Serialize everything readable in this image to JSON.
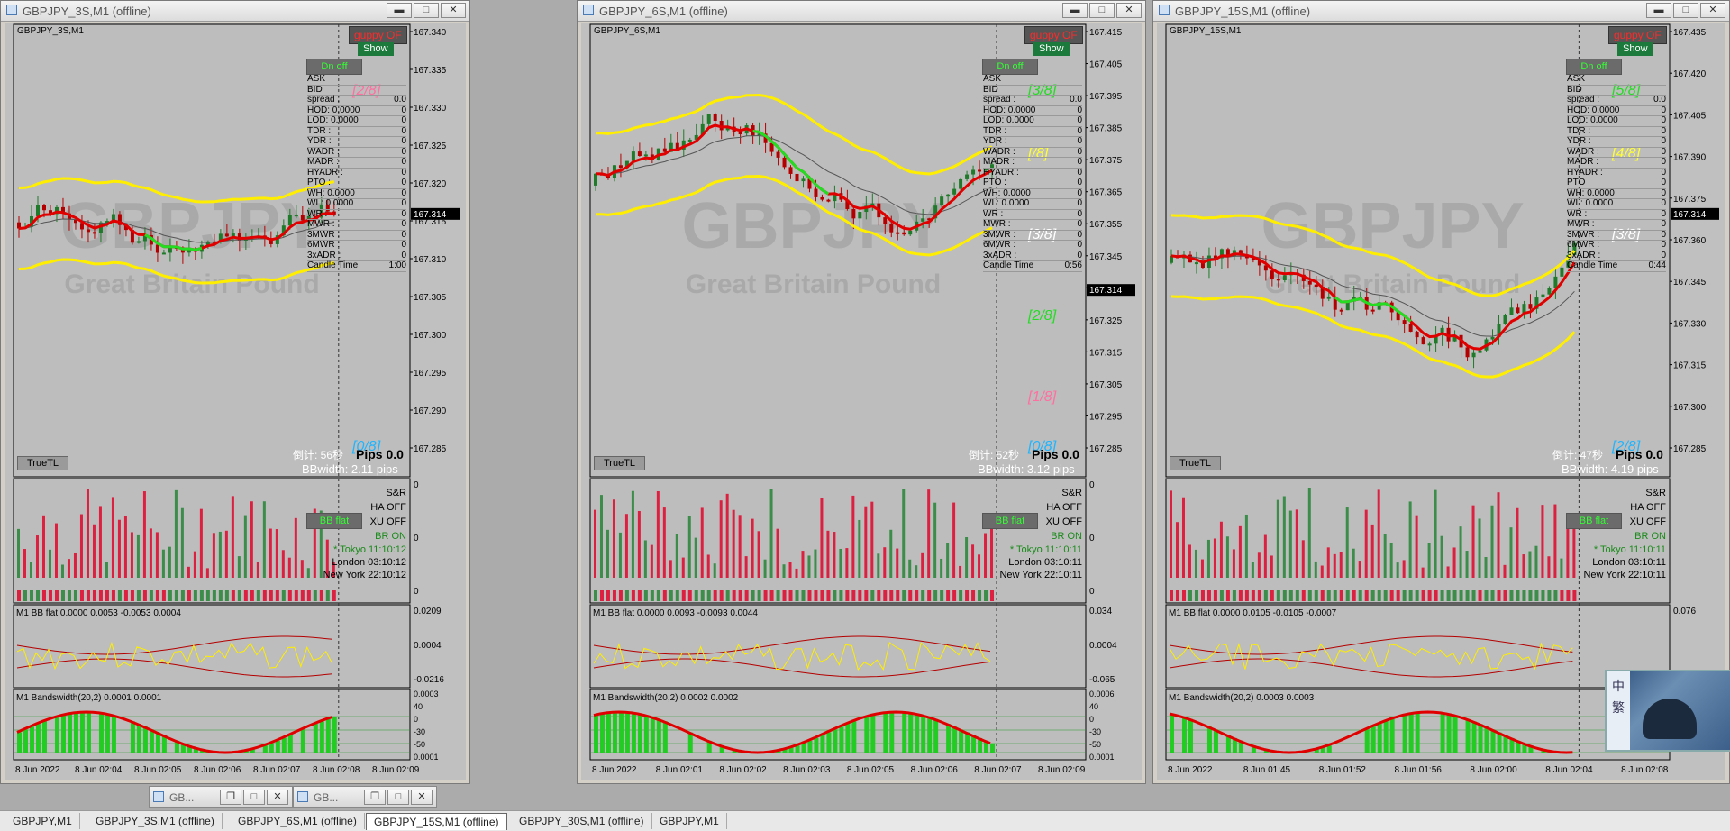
{
  "windows": [
    {
      "title": "GBPJPY_3S,M1 (offline)",
      "symbol_label": "GBPJPY_3S,M1",
      "price_ticks": [
        "167.340",
        "167.335",
        "167.330",
        "167.325",
        "167.320",
        "167.315",
        "167.310",
        "167.305",
        "167.300",
        "167.295",
        "167.290",
        "167.285"
      ],
      "current_price": "167.314",
      "time_labels": [
        "8 Jun 2022",
        "8 Jun 02:04",
        "8 Jun 02:05",
        "8 Jun 02:06",
        "8 Jun 02:07",
        "8 Jun 02:08",
        "8 Jun 02:09"
      ],
      "murrey_top": "[2/8]",
      "murrey_labels": [],
      "murrey_bottom": "[0/8]",
      "countdown": "倒计: 56秒",
      "bbwidth": "BBwidth: 2.11 pips",
      "candle_time": "1:00",
      "sessions": [
        {
          "name": "* Tokyo",
          "time": "11:10:12"
        },
        {
          "name": "London",
          "time": "03:10:12"
        },
        {
          "name": "New York",
          "time": "22:10:12"
        }
      ],
      "bbflat": "M1 BB flat 0.0000 0.0053 -0.0053 0.0004",
      "bbflat_ticks": [
        "0.0209",
        "0.0004",
        "-0.0216"
      ],
      "bw": "M1 Bandswidth(20,2) 0.0001 0.0001",
      "bw_ticks": [
        "0.0003",
        "40",
        "0",
        "-30",
        "-50",
        "0.0001"
      ],
      "vol_ticks": [
        "0",
        "0",
        "0"
      ]
    },
    {
      "title": "GBPJPY_6S,M1 (offline)",
      "symbol_label": "GBPJPY_6S,M1",
      "price_ticks": [
        "167.415",
        "167.405",
        "167.395",
        "167.385",
        "167.375",
        "167.365",
        "167.355",
        "167.345",
        "167.335",
        "167.325",
        "167.315",
        "167.305",
        "167.295",
        "167.285"
      ],
      "current_price": "167.314",
      "time_labels": [
        "8 Jun 2022",
        "8 Jun 02:01",
        "8 Jun 02:02",
        "8 Jun 02:03",
        "8 Jun 02:05",
        "8 Jun 02:06",
        "8 Jun 02:07",
        "8 Jun 02:09"
      ],
      "murrey_top": "[3/8]",
      "murrey_labels": [
        "[/8]",
        "[3/8]",
        "[2/8]",
        "[1/8]"
      ],
      "murrey_bottom": "[0/8]",
      "countdown": "倒计: 52秒",
      "bbwidth": "BBwidth: 3.12 pips",
      "candle_time": "0:56",
      "sessions": [
        {
          "name": "* Tokyo",
          "time": "11:10:11"
        },
        {
          "name": "London",
          "time": "03:10:11"
        },
        {
          "name": "New York",
          "time": "22:10:11"
        }
      ],
      "bbflat": "M1 BB flat 0.0000 0.0093 -0.0093 0.0044",
      "bbflat_ticks": [
        "0.034",
        "0.0004",
        "-0.065"
      ],
      "bw": "M1 Bandswidth(20,2) 0.0002 0.0002",
      "bw_ticks": [
        "0.0006",
        "40",
        "0",
        "-30",
        "-50",
        "0.0001"
      ],
      "vol_ticks": [
        "0",
        "0",
        "0"
      ]
    },
    {
      "title": "GBPJPY_15S,M1 (offline)",
      "symbol_label": "GBPJPY_15S,M1",
      "price_ticks": [
        "167.435",
        "167.420",
        "167.405",
        "167.390",
        "167.375",
        "167.360",
        "167.345",
        "167.330",
        "167.315",
        "167.300",
        "167.285"
      ],
      "current_price": "167.314",
      "time_labels": [
        "8 Jun 2022",
        "8 Jun 01:45",
        "8 Jun 01:52",
        "8 Jun 01:56",
        "8 Jun 02:00",
        "8 Jun 02:04",
        "8 Jun 02:08"
      ],
      "murrey_top": "[5/8]",
      "murrey_labels": [
        "[4/8]",
        "[3/8]"
      ],
      "murrey_bottom": "[2/8]",
      "countdown": "倒计: 47秒",
      "bbwidth": "BBwidth: 4.19 pips",
      "candle_time": "0:44",
      "sessions": [
        {
          "name": "* Tokyo",
          "time": "11:10:11"
        },
        {
          "name": "London",
          "time": "03:10:11"
        },
        {
          "name": "New York",
          "time": "22:10:11"
        }
      ],
      "bbflat": "M1 BB flat 0.0000 0.0105 -0.0105 -0.0007",
      "bbflat_ticks": [
        "0.076",
        "",
        ""
      ],
      "bw": "M1 Bandswidth(20,2) 0.0003 0.0003",
      "bw_ticks": [
        "",
        "",
        "",
        "",
        "",
        ""
      ],
      "vol_ticks": [
        "",
        "",
        ""
      ]
    }
  ],
  "common": {
    "guppy": "guppy OF",
    "show": "Show",
    "dn_off": "Dn off",
    "ask": "ASK",
    "bid": "BID",
    "spread_label": "spread :",
    "spread_value": "0.0",
    "hod": "HOD: 0.0000",
    "lod": "LOD: 0.0000",
    "stats": [
      "TDR :",
      "YDR :",
      "WADR :",
      "MADR :",
      "HYADR :",
      "PTO :"
    ],
    "wh": "WH: 0.0000",
    "wl": "WL: 0.0000",
    "stats2": [
      "WR :",
      "MWR :",
      "3MWR :",
      "6MWR :",
      "3xADR :"
    ],
    "candle_time_label": "Candle Time",
    "truetl": "TrueTL",
    "pips": "Pips 0.0",
    "sr": "S&R",
    "ha": "HA OFF",
    "xu": "XU OFF",
    "br": "BR ON",
    "bbflat_btn": "BB flat"
  },
  "minimized": [
    {
      "title": "GB..."
    },
    {
      "title": "GB..."
    }
  ],
  "taskbar_tabs": [
    {
      "label": "GBPJPY,M1",
      "active": false
    },
    {
      "label": "GBPJPY_3S,M1 (offline)",
      "active": false
    },
    {
      "label": "GBPJPY_6S,M1 (offline)",
      "active": false
    },
    {
      "label": "GBPJPY_15S,M1 (offline)",
      "active": true
    },
    {
      "label": "GBPJPY_30S,M1 (offline)",
      "active": false
    },
    {
      "label": "GBPJPY,M1",
      "active": false
    }
  ],
  "avatar_chars": [
    "中",
    "繁"
  ],
  "colors": {
    "bull": "#1f7a2a",
    "bear": "#b40000",
    "ema_red": "#e00000",
    "ema_green": "#22dd22",
    "band_yellow": "#ffee00",
    "murrey_pink": "#ff6fa0",
    "murrey_cyan": "#1fb5ff",
    "murrey_yellow": "#ffff33",
    "vol_bull": "#3c8c4a",
    "vol_bear": "#dc2040",
    "bw_fill": "#22cc22"
  }
}
